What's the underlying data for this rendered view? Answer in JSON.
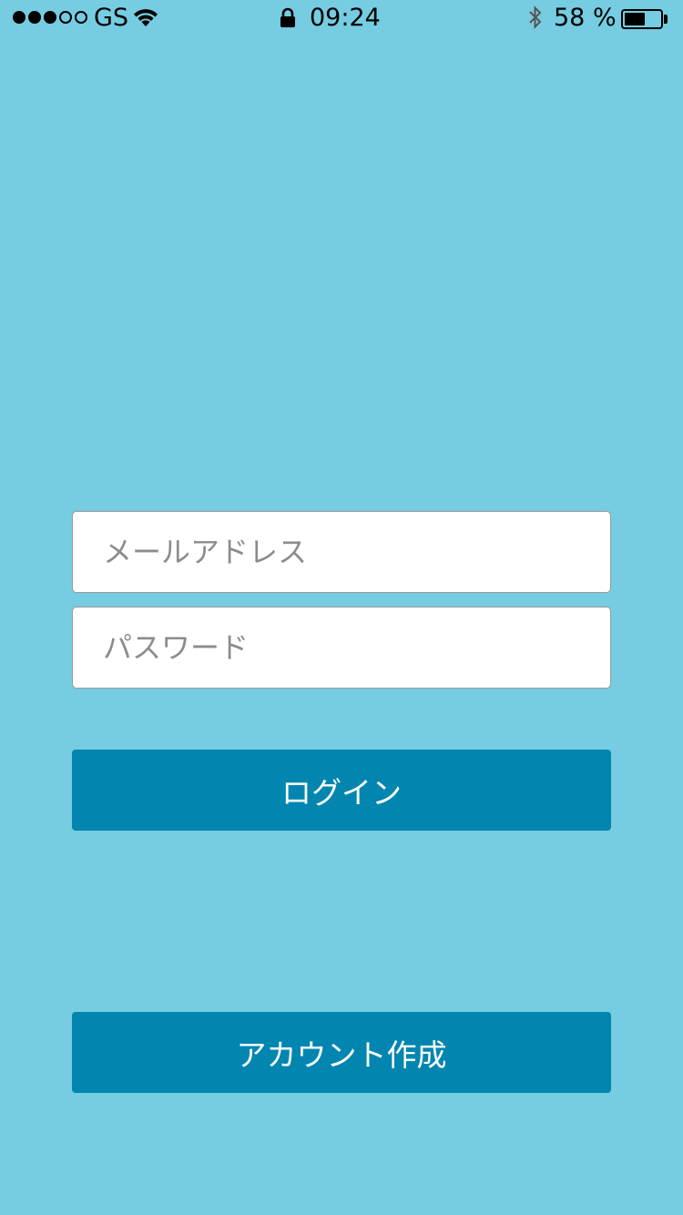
{
  "status_bar": {
    "carrier": "GS",
    "time": "09:24",
    "battery_percent": "58 %",
    "battery_level": 0.58,
    "signal_strength": 3,
    "signal_max": 5
  },
  "login_form": {
    "email_placeholder": "メールアドレス",
    "email_value": "",
    "password_placeholder": "パスワード",
    "password_value": "",
    "login_label": "ログイン"
  },
  "create_account_label": "アカウント作成",
  "colors": {
    "background": "#76cce1",
    "button": "#0286b0",
    "button_text": "#ffffff"
  }
}
